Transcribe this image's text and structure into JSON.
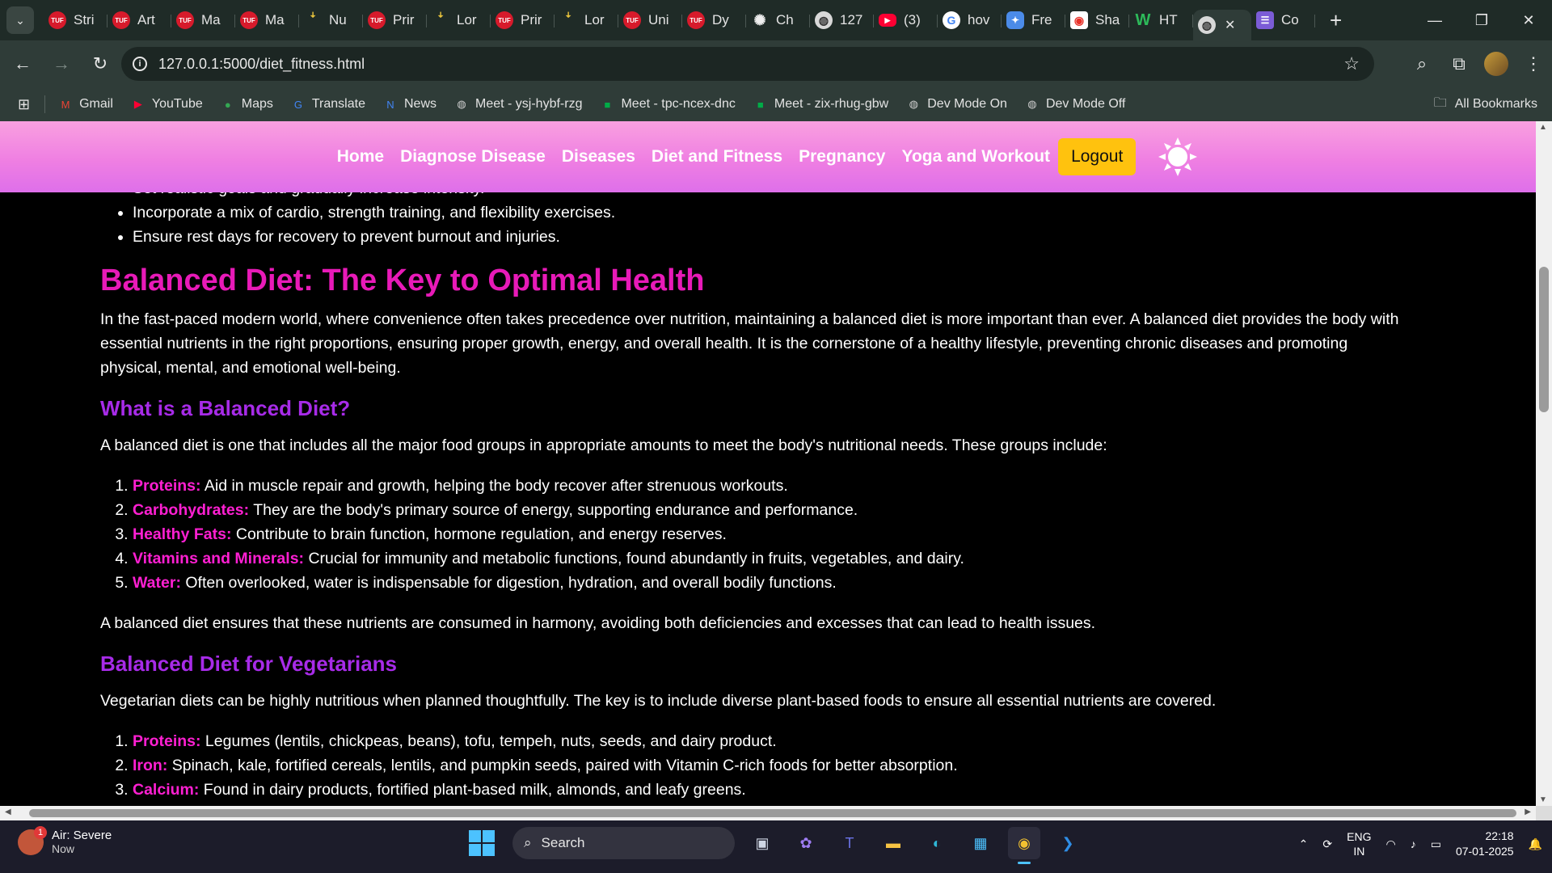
{
  "browser": {
    "tabs": [
      {
        "label": "Stri",
        "fav": "tuf",
        "icon": "tuf-icon"
      },
      {
        "label": "Art",
        "fav": "tuf",
        "icon": "tuf-icon"
      },
      {
        "label": "Ma",
        "fav": "tuf",
        "icon": "tuf-icon"
      },
      {
        "label": "Ma",
        "fav": "tuf",
        "icon": "tuf-icon"
      },
      {
        "label": "Nu",
        "fav": "lo",
        "icon": "leetcode-icon"
      },
      {
        "label": "Prir",
        "fav": "tuf",
        "icon": "tuf-icon"
      },
      {
        "label": "Lor",
        "fav": "lo",
        "icon": "leetcode-icon"
      },
      {
        "label": "Prir",
        "fav": "tuf",
        "icon": "tuf-icon"
      },
      {
        "label": "Lor",
        "fav": "lo",
        "icon": "leetcode-icon"
      },
      {
        "label": "Uni",
        "fav": "tuf",
        "icon": "tuf-icon"
      },
      {
        "label": "Dy",
        "fav": "tuf",
        "icon": "tuf-icon"
      },
      {
        "label": "Ch",
        "fav": "gpt",
        "icon": "chatgpt-icon"
      },
      {
        "label": "127",
        "fav": "globe",
        "icon": "globe-icon"
      },
      {
        "label": "(3)",
        "fav": "yt",
        "icon": "youtube-icon"
      },
      {
        "label": "hov",
        "fav": "g",
        "icon": "google-icon"
      },
      {
        "label": "Fre",
        "fav": "fre",
        "icon": "site-icon"
      },
      {
        "label": "Sha",
        "fav": "sh",
        "icon": "site-icon"
      },
      {
        "label": "HT",
        "fav": "w",
        "icon": "w3schools-icon"
      }
    ],
    "active_tab_close": "✕",
    "last_tab": {
      "label": "Co",
      "icon": "docs-icon"
    },
    "address": "127.0.0.1:5000/diet_fitness.html",
    "bookmarks": [
      {
        "label": "Gmail",
        "icon": "gmail-icon",
        "color": "#ea4335",
        "glyph": "M"
      },
      {
        "label": "YouTube",
        "icon": "youtube-icon",
        "color": "#ff0033",
        "glyph": "▶"
      },
      {
        "label": "Maps",
        "icon": "maps-icon",
        "color": "#34a853",
        "glyph": "●"
      },
      {
        "label": "Translate",
        "icon": "translate-icon",
        "color": "#4285f4",
        "glyph": "G"
      },
      {
        "label": "News",
        "icon": "news-icon",
        "color": "#4285f4",
        "glyph": "N"
      },
      {
        "label": "Meet - ysj-hybf-rzg",
        "icon": "globe-icon",
        "color": "#cfcfcf",
        "glyph": "◍"
      },
      {
        "label": "Meet - tpc-ncex-dnc",
        "icon": "meet-icon",
        "color": "#00ac47",
        "glyph": "■"
      },
      {
        "label": "Meet - zix-rhug-gbw",
        "icon": "meet-icon",
        "color": "#00ac47",
        "glyph": "■"
      },
      {
        "label": "Dev Mode On",
        "icon": "globe-icon",
        "color": "#cfcfcf",
        "glyph": "◍"
      },
      {
        "label": "Dev Mode Off",
        "icon": "globe-icon",
        "color": "#cfcfcf",
        "glyph": "◍"
      }
    ],
    "all_bookmarks": "All Bookmarks"
  },
  "site": {
    "nav": [
      "Home",
      "Diagnose Disease",
      "Diseases",
      "Diet and Fitness",
      "Pregnancy",
      "Yoga and Workout"
    ],
    "logout": "Logout",
    "tips": [
      "Set realistic goals and gradually increase intensity.",
      "Incorporate a mix of cardio, strength training, and flexibility exercises.",
      "Ensure rest days for recovery to prevent burnout and injuries."
    ],
    "h2": "Balanced Diet: The Key to Optimal Health",
    "intro": "In the fast-paced modern world, where convenience often takes precedence over nutrition, maintaining a balanced diet is more important than ever. A balanced diet provides the body with essential nutrients in the right proportions, ensuring proper growth, energy, and overall health. It is the cornerstone of a healthy lifestyle, preventing chronic diseases and promoting physical, mental, and emotional well-being.",
    "h3_what": "What is a Balanced Diet?",
    "what_text": "A balanced diet is one that includes all the major food groups in appropriate amounts to meet the body's nutritional needs. These groups include:",
    "groups": [
      {
        "term": "Proteins:",
        "desc": " Aid in muscle repair and growth, helping the body recover after strenuous workouts."
      },
      {
        "term": "Carbohydrates:",
        "desc": " They are the body's primary source of energy, supporting endurance and performance."
      },
      {
        "term": "Healthy Fats:",
        "desc": " Contribute to brain function, hormone regulation, and energy reserves."
      },
      {
        "term": "Vitamins and Minerals:",
        "desc": " Crucial for immunity and metabolic functions, found abundantly in fruits, vegetables, and dairy."
      },
      {
        "term": "Water:",
        "desc": " Often overlooked, water is indispensable for digestion, hydration, and overall bodily functions."
      }
    ],
    "after_groups": "A balanced diet ensures that these nutrients are consumed in harmony, avoiding both deficiencies and excesses that can lead to health issues.",
    "h3_veg": "Balanced Diet for Vegetarians",
    "veg_text": "Vegetarian diets can be highly nutritious when planned thoughtfully. The key is to include diverse plant-based foods to ensure all essential nutrients are covered.",
    "veg": [
      {
        "term": "Proteins:",
        "desc": " Legumes (lentils, chickpeas, beans), tofu, tempeh, nuts, seeds, and dairy product."
      },
      {
        "term": "Iron:",
        "desc": " Spinach, kale, fortified cereals, lentils, and pumpkin seeds, paired with Vitamin C-rich foods for better absorption."
      },
      {
        "term": "Calcium:",
        "desc": " Found in dairy products, fortified plant-based milk, almonds, and leafy greens."
      }
    ]
  },
  "taskbar": {
    "weather_title": "Air: Severe",
    "weather_sub": "Now",
    "weather_badge": "1",
    "search": "Search",
    "lang1": "ENG",
    "lang2": "IN",
    "time": "22:18",
    "date": "07-01-2025"
  },
  "colors": {
    "heading": "#e81ab8",
    "subheading": "#a72be8",
    "term": "#ff1fd2",
    "logout": "#ffc20e"
  }
}
